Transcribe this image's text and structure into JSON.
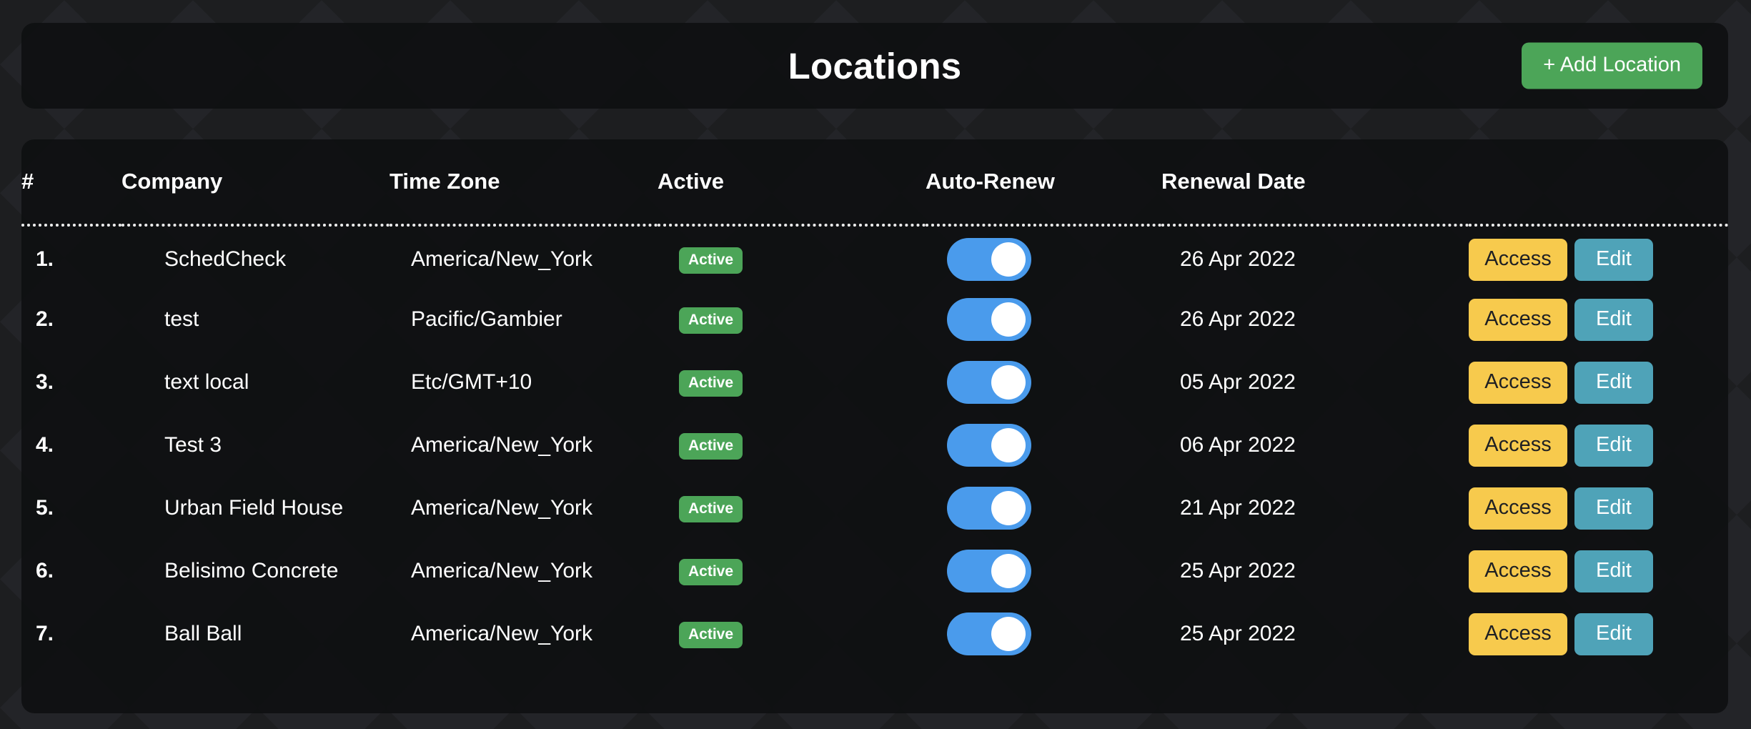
{
  "header": {
    "title": "Locations",
    "add_button_label": "+ Add Location",
    "add_button_color": "#4ca558"
  },
  "table": {
    "columns": [
      {
        "key": "num",
        "label": "#"
      },
      {
        "key": "company",
        "label": "Company"
      },
      {
        "key": "timezone",
        "label": "Time Zone"
      },
      {
        "key": "active",
        "label": "Active"
      },
      {
        "key": "renew",
        "label": "Auto-Renew"
      },
      {
        "key": "date",
        "label": "Renewal Date"
      },
      {
        "key": "actions",
        "label": ""
      }
    ],
    "action_labels": {
      "access": "Access",
      "edit": "Edit"
    },
    "colors": {
      "badge_active": "#4ca558",
      "toggle_on": "#4a9bec",
      "access_button": "#f7ca4d",
      "edit_button": "#4fa3b8",
      "card_background": "#0e0f11",
      "page_background": "#232428"
    },
    "rows": [
      {
        "num": "1.",
        "company": "SchedCheck",
        "timezone": "America/New_York",
        "active_label": "Active",
        "auto_renew": true,
        "date": "26 Apr 2022"
      },
      {
        "num": "2.",
        "company": "test",
        "timezone": "Pacific/Gambier",
        "active_label": "Active",
        "auto_renew": true,
        "date": "26 Apr 2022"
      },
      {
        "num": "3.",
        "company": "text local",
        "timezone": "Etc/GMT+10",
        "active_label": "Active",
        "auto_renew": true,
        "date": "05 Apr 2022"
      },
      {
        "num": "4.",
        "company": "Test 3",
        "timezone": "America/New_York",
        "active_label": "Active",
        "auto_renew": true,
        "date": "06 Apr 2022"
      },
      {
        "num": "5.",
        "company": "Urban Field House",
        "timezone": "America/New_York",
        "active_label": "Active",
        "auto_renew": true,
        "date": "21 Apr 2022"
      },
      {
        "num": "6.",
        "company": "Belisimo Concrete",
        "timezone": "America/New_York",
        "active_label": "Active",
        "auto_renew": true,
        "date": "25 Apr 2022"
      },
      {
        "num": "7.",
        "company": "Ball Ball",
        "timezone": "America/New_York",
        "active_label": "Active",
        "auto_renew": true,
        "date": "25 Apr 2022"
      }
    ]
  }
}
